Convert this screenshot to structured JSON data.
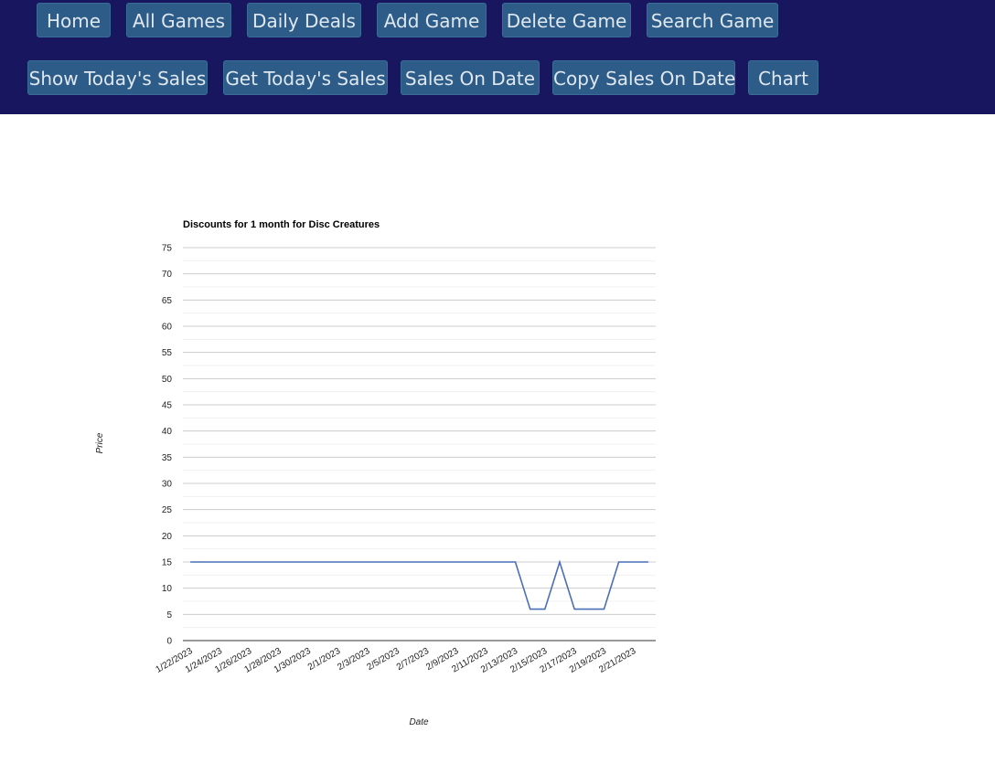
{
  "nav": {
    "row1": [
      {
        "id": "home",
        "label": "Home"
      },
      {
        "id": "all-games",
        "label": "All Games"
      },
      {
        "id": "daily-deals",
        "label": "Daily Deals"
      },
      {
        "id": "add-game",
        "label": "Add Game"
      },
      {
        "id": "delete-game",
        "label": "Delete Game"
      },
      {
        "id": "search-game",
        "label": "Search Game"
      }
    ],
    "row2": [
      {
        "id": "show-todays-sales",
        "label": "Show Today's Sales"
      },
      {
        "id": "get-todays-sales",
        "label": "Get Today's Sales"
      },
      {
        "id": "sales-on-date",
        "label": "Sales On Date"
      },
      {
        "id": "copy-sales-on-date",
        "label": "Copy Sales On Date"
      },
      {
        "id": "chart",
        "label": "Chart"
      }
    ]
  },
  "colors": {
    "navbar_bg": "#191660",
    "button_bg": "#2d5c88",
    "line": "#4a6fb5"
  },
  "chart_data": {
    "type": "line",
    "title": "Discounts for 1 month for Disc Creatures",
    "xlabel": "Date",
    "ylabel": "Price",
    "ylim": [
      0,
      75
    ],
    "yticks": [
      0,
      5,
      10,
      15,
      20,
      25,
      30,
      35,
      40,
      45,
      50,
      55,
      60,
      65,
      70,
      75
    ],
    "x": [
      "1/22/2023",
      "1/23/2023",
      "1/24/2023",
      "1/25/2023",
      "1/26/2023",
      "1/27/2023",
      "1/28/2023",
      "1/29/2023",
      "1/30/2023",
      "1/31/2023",
      "2/1/2023",
      "2/2/2023",
      "2/3/2023",
      "2/4/2023",
      "2/5/2023",
      "2/6/2023",
      "2/7/2023",
      "2/8/2023",
      "2/9/2023",
      "2/10/2023",
      "2/11/2023",
      "2/12/2023",
      "2/13/2023",
      "2/14/2023",
      "2/15/2023",
      "2/16/2023",
      "2/17/2023",
      "2/18/2023",
      "2/19/2023",
      "2/20/2023",
      "2/21/2023",
      "2/22/2023"
    ],
    "xtick_labels": [
      "1/22/2023",
      "1/24/2023",
      "1/26/2023",
      "1/28/2023",
      "1/30/2023",
      "2/1/2023",
      "2/3/2023",
      "2/5/2023",
      "2/7/2023",
      "2/9/2023",
      "2/11/2023",
      "2/13/2023",
      "2/15/2023",
      "2/17/2023",
      "2/19/2023",
      "2/21/2023"
    ],
    "series": [
      {
        "values": [
          15,
          15,
          15,
          15,
          15,
          15,
          15,
          15,
          15,
          15,
          15,
          15,
          15,
          15,
          15,
          15,
          15,
          15,
          15,
          15,
          15,
          15,
          15,
          6,
          6,
          15,
          6,
          6,
          6,
          15,
          15,
          15
        ]
      }
    ],
    "grid": true,
    "legend": "none"
  }
}
